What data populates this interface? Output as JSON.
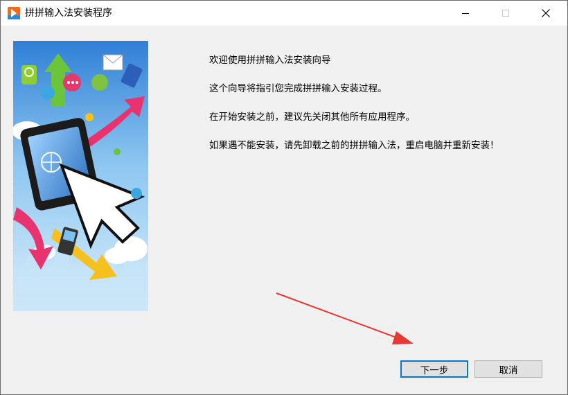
{
  "window": {
    "title": "拼拼输入法安装程序",
    "controls": {
      "minimize_icon": "minimize-icon",
      "maximize_icon": "maximize-icon",
      "close_icon": "close-icon"
    }
  },
  "content": {
    "heading": "欢迎使用拼拼输入法安装向导",
    "line1": "这个向导将指引您完成拼拼输入安装过程。",
    "line2": "在开始安装之前，建议先关闭其他所有应用程序。",
    "line3": "如果遇不能安装，请先卸载之前的拼拼输入法，重启电脑并重新安装！"
  },
  "buttons": {
    "next_label": "下一步",
    "cancel_label": "取消"
  },
  "colors": {
    "annotation_arrow": "#e53935",
    "accent": "#0078d7",
    "app_icon": "#f26b1d"
  }
}
